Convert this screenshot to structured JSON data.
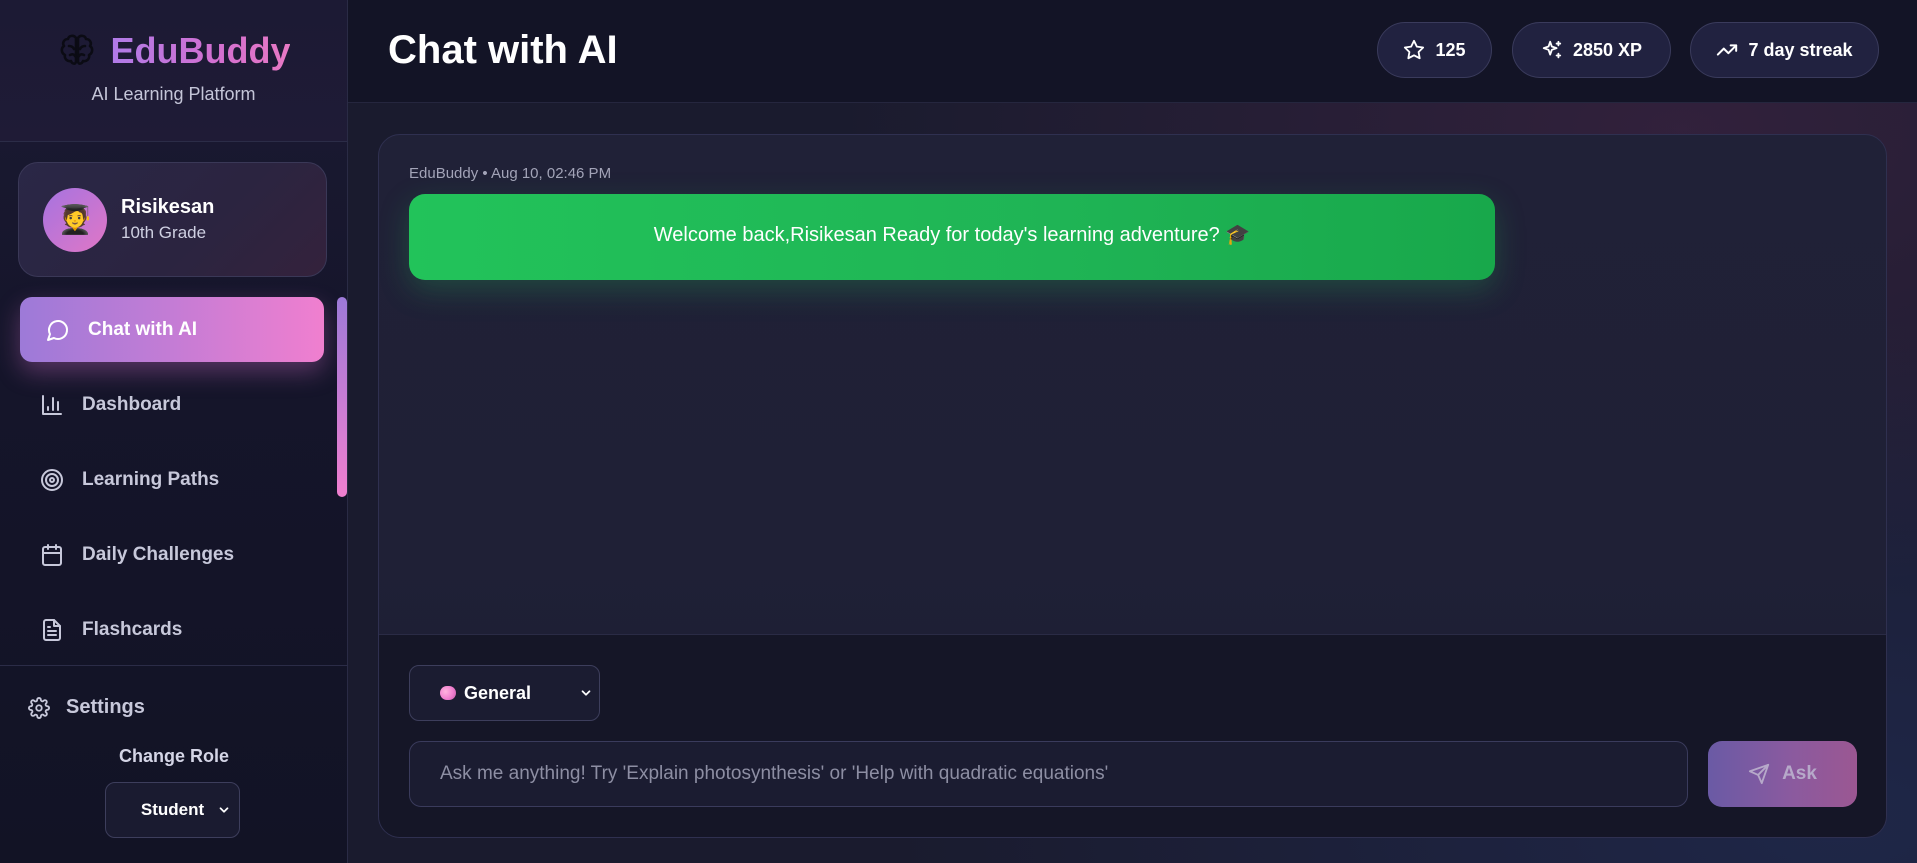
{
  "brand": {
    "name": "EduBuddy",
    "subtitle": "AI Learning Platform",
    "logo_icon": "brain-icon"
  },
  "profile": {
    "name": "Risikesan",
    "grade": "10th Grade",
    "avatar_emoji": "🧑‍🎓"
  },
  "nav": {
    "items": [
      {
        "label": "Chat with AI",
        "icon": "chat-bubble-icon",
        "active": true
      },
      {
        "label": "Dashboard",
        "icon": "bar-chart-icon",
        "active": false
      },
      {
        "label": "Learning Paths",
        "icon": "target-icon",
        "active": false
      },
      {
        "label": "Daily Challenges",
        "icon": "calendar-icon",
        "active": false
      },
      {
        "label": "Flashcards",
        "icon": "document-icon",
        "active": false
      }
    ]
  },
  "sidebar_bottom": {
    "settings_label": "Settings",
    "change_role_label": "Change Role",
    "role_value": "Student"
  },
  "header": {
    "title": "Chat with AI",
    "stars": "125",
    "xp": "2850 XP",
    "streak": "7 day streak"
  },
  "chat": {
    "messages": [
      {
        "author": "EduBuddy",
        "meta": "EduBuddy • Aug 10, 02:46 PM",
        "text": "Welcome back,Risikesan Ready for today's learning adventure? 🎓"
      }
    ]
  },
  "composer": {
    "topic_value": "General",
    "input_placeholder": "Ask me anything! Try 'Explain photosynthesis' or 'Help with quadratic equations'",
    "input_value": "",
    "ask_label": "Ask"
  },
  "colors": {
    "accent_gradient_start": "#9d7ad8",
    "accent_gradient_end": "#f07fcf",
    "message_bubble": "#22c35a",
    "background": "#1a1b2e"
  }
}
